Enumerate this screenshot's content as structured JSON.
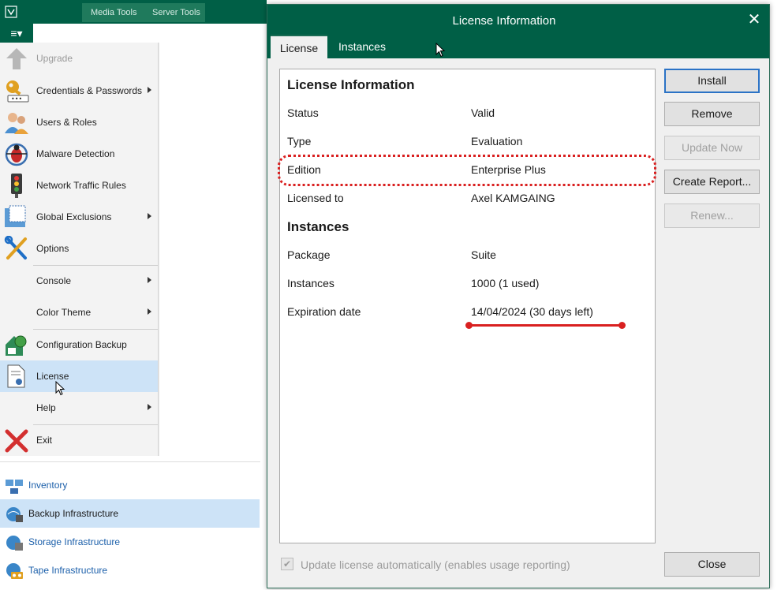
{
  "ribbon": {
    "tabs": [
      "Media Tools",
      "Server Tools"
    ]
  },
  "main_menu": {
    "items": [
      {
        "label": "Upgrade",
        "icon": "upgrade-arrow-icon",
        "disabled": true,
        "submenu": false
      },
      {
        "label": "Credentials & Passwords",
        "icon": "key-icon",
        "submenu": true
      },
      {
        "label": "Users & Roles",
        "icon": "users-icon",
        "submenu": false
      },
      {
        "label": "Malware Detection",
        "icon": "bug-icon",
        "submenu": false
      },
      {
        "label": "Network Traffic Rules",
        "icon": "traffic-light-icon",
        "submenu": false
      },
      {
        "label": "Global Exclusions",
        "icon": "exclusions-icon",
        "submenu": true
      },
      {
        "label": "Options",
        "icon": "tools-icon",
        "submenu": false
      },
      {
        "label": "Console",
        "icon": "",
        "submenu": true
      },
      {
        "label": "Color Theme",
        "icon": "",
        "submenu": true
      },
      {
        "label": "Configuration Backup",
        "icon": "config-backup-icon",
        "submenu": false
      },
      {
        "label": "License",
        "icon": "license-icon",
        "submenu": false,
        "selected": true
      },
      {
        "label": "Help",
        "icon": "",
        "submenu": true
      },
      {
        "label": "Exit",
        "icon": "exit-x-icon",
        "submenu": false
      }
    ]
  },
  "nav_pane": {
    "items": [
      {
        "label": "Inventory",
        "icon": "inventory-icon"
      },
      {
        "label": "Backup Infrastructure",
        "icon": "backup-infrastructure-icon",
        "selected": true
      },
      {
        "label": "Storage Infrastructure",
        "icon": "storage-infrastructure-icon"
      },
      {
        "label": "Tape Infrastructure",
        "icon": "tape-infrastructure-icon"
      }
    ]
  },
  "dialog": {
    "title": "License Information",
    "tabs": [
      "License",
      "Instances"
    ],
    "active_tab": "License",
    "sections": {
      "license": {
        "heading": "License Information",
        "rows": [
          {
            "key": "Status",
            "value": "Valid"
          },
          {
            "key": "Type",
            "value": "Evaluation"
          },
          {
            "key": "Edition",
            "value": "Enterprise Plus"
          },
          {
            "key": "Licensed to",
            "value": "Axel KAMGAING"
          }
        ]
      },
      "instances": {
        "heading": "Instances",
        "rows": [
          {
            "key": "Package",
            "value": "Suite"
          },
          {
            "key": "Instances",
            "value": "1000 (1 used)"
          },
          {
            "key": "Expiration date",
            "value": "14/04/2024 (30 days left)"
          }
        ]
      }
    },
    "buttons": {
      "install": "Install",
      "remove": "Remove",
      "update_now": "Update Now",
      "create_report": "Create Report...",
      "renew": "Renew...",
      "close": "Close"
    },
    "auto_update": {
      "label": "Update license automatically (enables usage reporting)",
      "checked": true,
      "disabled": true
    }
  },
  "colors": {
    "brand_green": "#005f46",
    "annotation_red": "#d92020",
    "selection_blue": "#cde3f7"
  }
}
